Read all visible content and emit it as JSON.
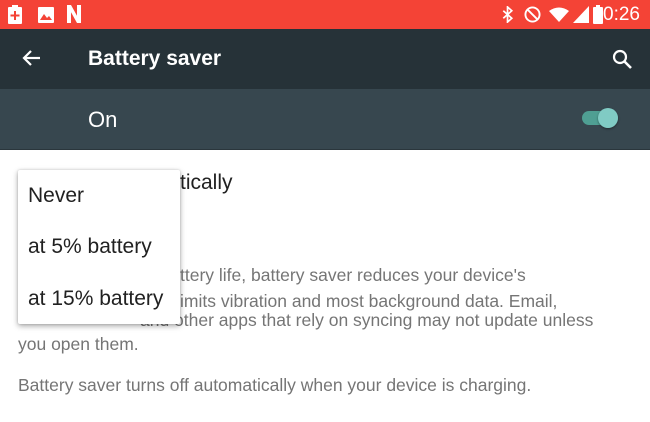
{
  "status_bar": {
    "time": "10:26",
    "left_icons": [
      "battery-plus-icon",
      "image-icon",
      "netflix-icon"
    ],
    "right_icons": [
      "bluetooth-icon",
      "do-not-disturb-icon",
      "wifi-icon",
      "signal-icon",
      "battery-icon"
    ],
    "background_color": "#f44336"
  },
  "toolbar": {
    "title": "Battery saver",
    "back_icon": "arrow-left-icon",
    "search_icon": "search-icon",
    "background_color": "#263238"
  },
  "master_switch": {
    "label": "On",
    "state": true,
    "accent_color": "#80cbc4",
    "background_color": "#37474f"
  },
  "settings": {
    "auto_title_visible": "tically",
    "description": "ttery life, battery saver reduces your device's imits vibration and most background data. Email, , and other apps that rely on syncing may not update unless you open them.",
    "description_lines": [
      "ttery life, battery saver reduces your device's",
      "imits vibration and most background data. Email,",
      "you open them."
    ],
    "description_line3_visible": "and other apps that rely on syncing may not update unless",
    "charging_note": "Battery saver turns off automatically when your device is charging."
  },
  "dropdown": {
    "options": [
      "Never",
      "at 5% battery",
      "at 15% battery"
    ]
  }
}
